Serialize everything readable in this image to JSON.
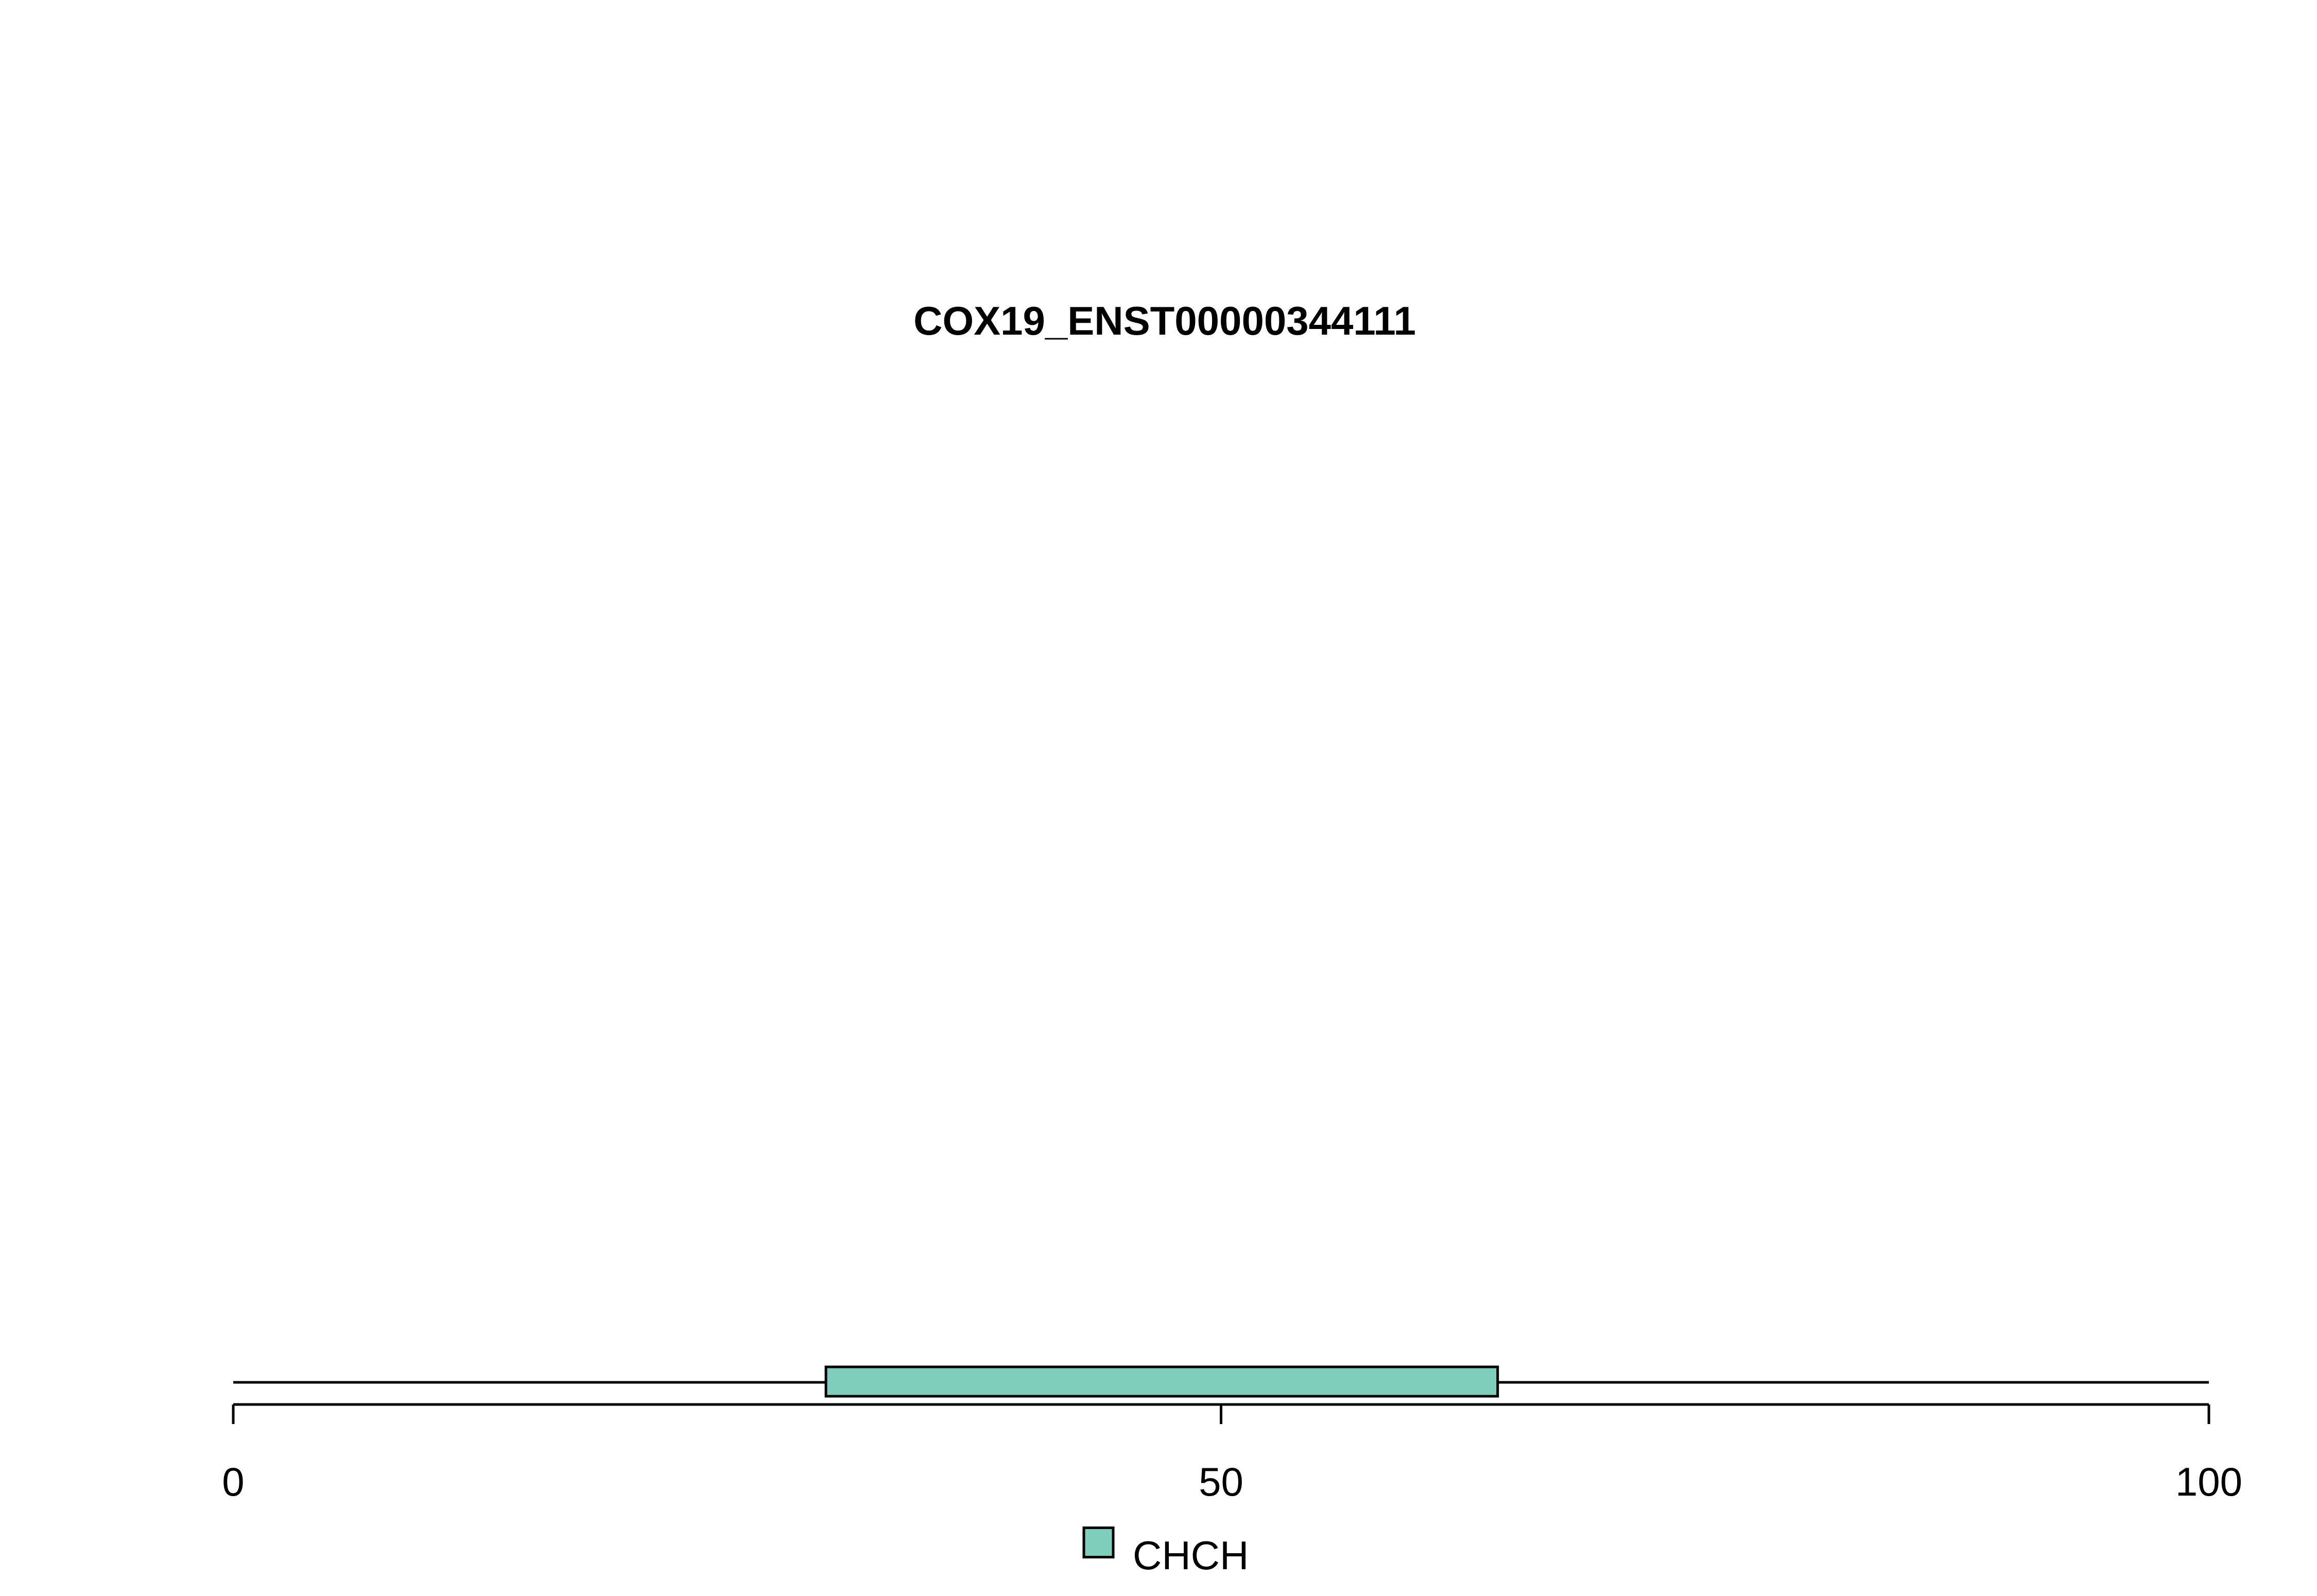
{
  "chart_data": {
    "type": "bar",
    "title": "COX19_ENST00000344111",
    "xlim": [
      0,
      100
    ],
    "x_ticks": [
      {
        "value": 0,
        "label": "0"
      },
      {
        "value": 50,
        "label": "50"
      },
      {
        "value": 100,
        "label": "100"
      }
    ],
    "backbone": {
      "start": 0,
      "end": 100
    },
    "domains": [
      {
        "name": "CHCH",
        "start": 30,
        "end": 64,
        "color": "#7fcdbb"
      }
    ],
    "legend": {
      "placement": "bottom-center",
      "entries": [
        {
          "label": "CHCH",
          "color": "#7fcdbb"
        }
      ]
    }
  }
}
